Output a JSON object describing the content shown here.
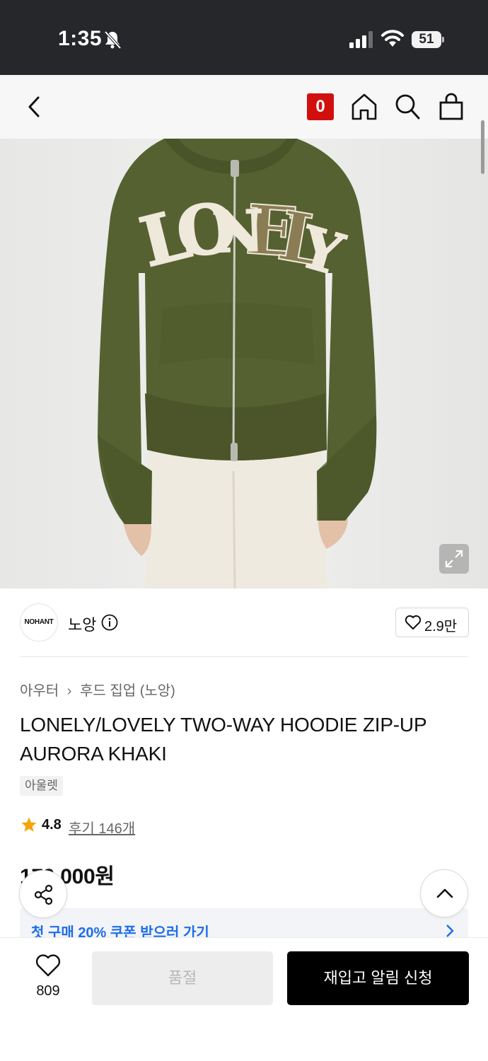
{
  "status_bar": {
    "time": "1:35",
    "battery": "51"
  },
  "header": {
    "cart_count": "0"
  },
  "brand": {
    "logo_text": "NOHANT",
    "name": "노앙",
    "likes": "2.9만"
  },
  "product": {
    "breadcrumb": [
      "아우터",
      "후드 집업 (노앙)"
    ],
    "title": "LONELY/LOVELY TWO-WAY HOODIE ZIP-UP AURORA KHAKI",
    "tag": "아울렛",
    "rating": "4.8",
    "reviews": "후기 146개",
    "price": "179,000원",
    "print_text": "LONELY"
  },
  "coupon": {
    "text": "첫 구매 20% 쿠폰 받으러 가기"
  },
  "bottom_bar": {
    "wish_count": "809",
    "soldout_label": "품절",
    "restock_label": "재입고 알림 신청"
  },
  "colors": {
    "accent_red": "#d20f0f",
    "coupon_blue": "#1e6ee8",
    "hoodie_khaki": "#566131",
    "star": "#f5a30a"
  }
}
